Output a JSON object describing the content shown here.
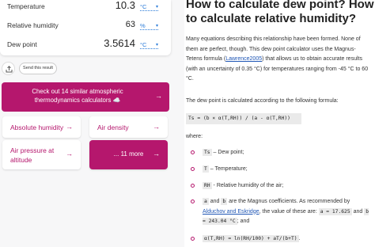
{
  "calculator": {
    "rows": [
      {
        "label": "Temperature",
        "value": "10.3",
        "unit": "°C"
      },
      {
        "label": "Relative humidity",
        "value": "63",
        "unit": "%"
      },
      {
        "label": "Dew point",
        "value": "3.5614",
        "unit": "°C"
      }
    ],
    "send_label": "Send this result"
  },
  "promo": {
    "banner_text": "Check out 14 similar atmospheric thermodynamics calculators ☁️",
    "links": [
      {
        "label": "Absolute humidity"
      },
      {
        "label": "Air density"
      },
      {
        "label": "Air pressure at altitude"
      }
    ],
    "more_label": "... 11 more",
    "arrow": "→"
  },
  "article": {
    "title": "How to calculate dew point? How to calculate relative humidity?",
    "p1": "Many equations describing this relationship have been formed. None of them are perfect, though. This dew point calculator uses the Magnus-Tetens formula (",
    "p1_link": "Lawrence2005",
    "p1_end": ") that allows us to obtain accurate results (with an uncertainty of 0.35 °C) for temperatures ranging from -45 °C to 60 °C.",
    "p2": "The dew point is calculated according to the following formula:",
    "formula": "Ts = (b × α(T,RH)) / (a - α(T,RH))",
    "where": "where:",
    "bullets": [
      {
        "code": "Ts",
        "text": " – Dew point;"
      },
      {
        "code": "T",
        "text": " – Temperature;"
      },
      {
        "code": "RH",
        "text": " - Relative humidity of the air;"
      }
    ],
    "b4_code_a": "a",
    "b4_and1": " and ",
    "b4_code_b": "b",
    "b4_text": " are the Magnus coefficients. As recommended by ",
    "b4_link": "Alduchov and Eskridge",
    "b4_text2": ", the value of these are: ",
    "b4_code_aval": "a = 17.625",
    "b4_and2": " and ",
    "b4_code_bval": "b = 243.04 °C",
    "b4_end": "; and",
    "b5_code": "α(T,RH) = ln(RH/100) + aT/(b+T)",
    "b5_end": "."
  }
}
